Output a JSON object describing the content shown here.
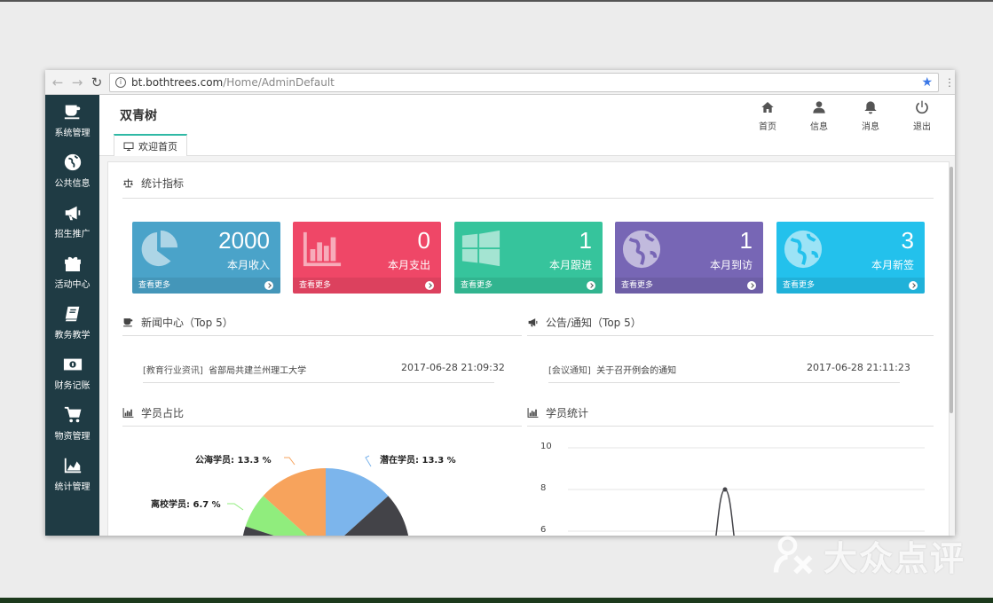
{
  "browser": {
    "url_host": "bt.bothtrees.com",
    "url_path": "/Home/AdminDefault",
    "info_glyph": "i"
  },
  "watermark": {
    "text": "大众点评"
  },
  "sidebar": {
    "items": [
      {
        "label": "系统管理",
        "icon": "coffee-cup-icon"
      },
      {
        "label": "公共信息",
        "icon": "globe-icon"
      },
      {
        "label": "招生推广",
        "icon": "megaphone-icon"
      },
      {
        "label": "活动中心",
        "icon": "gift-icon"
      },
      {
        "label": "教务教学",
        "icon": "book-icon"
      },
      {
        "label": "财务记账",
        "icon": "money-icon"
      },
      {
        "label": "物资管理",
        "icon": "cart-icon"
      },
      {
        "label": "统计管理",
        "icon": "area-chart-icon"
      }
    ]
  },
  "header": {
    "brand": "双青树",
    "tab_label": "欢迎首页",
    "nav": [
      {
        "label": "首页",
        "icon": "home-icon"
      },
      {
        "label": "信息",
        "icon": "user-icon"
      },
      {
        "label": "消息",
        "icon": "bell-icon"
      },
      {
        "label": "退出",
        "icon": "power-icon"
      }
    ]
  },
  "stats": {
    "title": "统计指标",
    "more_label": "查看更多",
    "cards": [
      {
        "value": "2000",
        "label": "本月收入",
        "color": "#4aa3c9",
        "icon": "pie-chart-icon"
      },
      {
        "value": "0",
        "label": "本月支出",
        "color": "#ef4767",
        "icon": "bar-chart-icon"
      },
      {
        "value": "1",
        "label": "本月跟进",
        "color": "#36c49c",
        "icon": "windows-icon"
      },
      {
        "value": "1",
        "label": "本月到访",
        "color": "#7766b5",
        "icon": "globe-icon"
      },
      {
        "value": "3",
        "label": "本月新签",
        "color": "#23c1ec",
        "icon": "globe-icon"
      }
    ]
  },
  "news": {
    "title": "新闻中心（Top 5）",
    "items": [
      {
        "category": "[教育行业资讯]",
        "title": "省部局共建兰州理工大学",
        "time": "2017-06-28 21:09:32"
      }
    ]
  },
  "notices": {
    "title": "公告/通知（Top 5）",
    "items": [
      {
        "category": "[会议通知]",
        "title": "关于召开例会的通知",
        "time": "2017-06-28 21:11:23"
      }
    ]
  },
  "student_ratio": {
    "title": "学员占比",
    "slices": [
      {
        "name": "潜在学员",
        "label": "潜在学员: 13.3 %",
        "percent": 13.3,
        "color": "#7cb5ec"
      },
      {
        "name": "other",
        "label": "",
        "percent": 13.3,
        "color": "#434348"
      },
      {
        "name": "离校学员",
        "label": "离校学员: 6.7 %",
        "percent": 6.7,
        "color": "#90ed7d"
      },
      {
        "name": "公海学员",
        "label": "公海学员: 13.3 %",
        "percent": 13.3,
        "color": "#f7a35c"
      }
    ]
  },
  "chart_data": {
    "type": "line",
    "title": "学员统计",
    "ylim": [
      6,
      10
    ],
    "yticks": [
      10,
      8,
      6
    ],
    "series": [
      {
        "peak": 8
      }
    ],
    "grid": true
  }
}
